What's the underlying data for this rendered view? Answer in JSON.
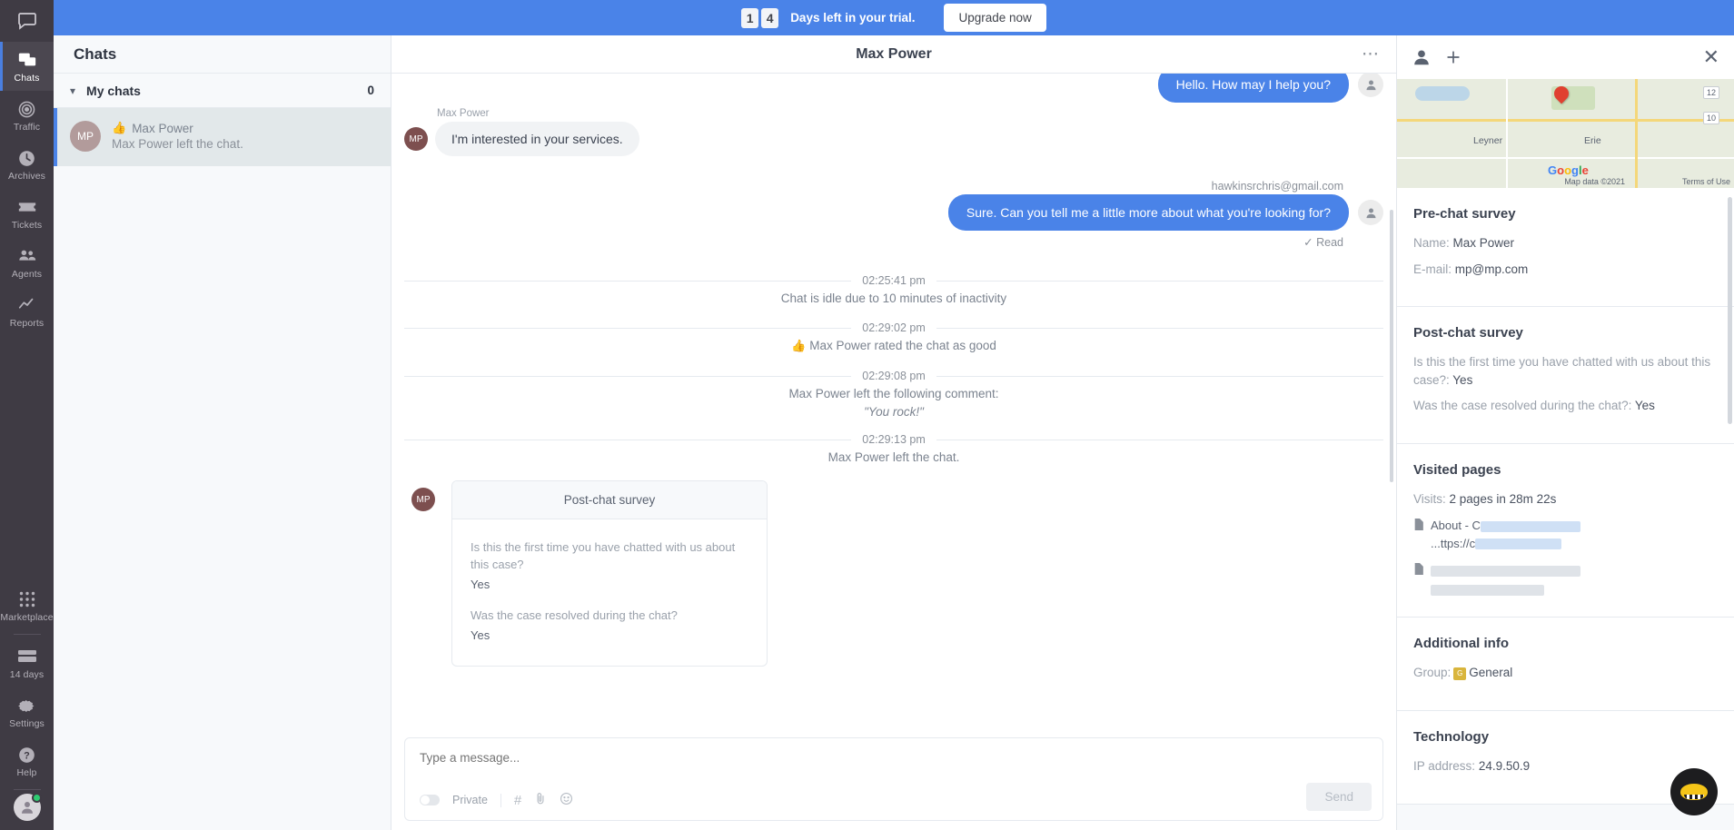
{
  "banner": {
    "digits": [
      "1",
      "4"
    ],
    "text": "Days left in your trial.",
    "upgrade_label": "Upgrade now"
  },
  "rail": {
    "logo_icon": "chat-bubble-logo-icon",
    "items": [
      {
        "label": "Chats",
        "icon": "chats-icon",
        "active": true
      },
      {
        "label": "Traffic",
        "icon": "traffic-icon",
        "active": false
      },
      {
        "label": "Archives",
        "icon": "clock-icon",
        "active": false
      },
      {
        "label": "Tickets",
        "icon": "ticket-icon",
        "active": false
      },
      {
        "label": "Agents",
        "icon": "agents-icon",
        "active": false
      },
      {
        "label": "Reports",
        "icon": "reports-icon",
        "active": false
      }
    ],
    "bottom_items": [
      {
        "label": "Marketplace",
        "icon": "grid-icon"
      },
      {
        "label": "14 days",
        "icon": "card-icon"
      },
      {
        "label": "Settings",
        "icon": "gear-icon"
      },
      {
        "label": "Help",
        "icon": "question-icon"
      }
    ]
  },
  "chatlist": {
    "header": "Chats",
    "group_label": "My chats",
    "group_count": "0",
    "items": [
      {
        "initials": "MP",
        "name": "Max Power",
        "snippet": "Max Power left the chat.",
        "rating_icon": "thumbs-up-icon"
      }
    ]
  },
  "conversation": {
    "title": "Max Power",
    "more_icon": "more-options-icon",
    "messages": {
      "greeting_out": "Hello. How may I help you?",
      "sender_label": "Max Power",
      "incoming_1": "I'm interested in your services.",
      "agent_email": "hawkinsrchris@gmail.com",
      "outgoing_1": "Sure. Can you tell me a little more about what you're looking for?",
      "read_status": "✓ Read"
    },
    "system_events": [
      {
        "time": "02:25:41 pm",
        "text": "Chat is idle due to 10 minutes of inactivity",
        "icon": ""
      },
      {
        "time": "02:29:02 pm",
        "text": "Max Power rated the chat as good",
        "icon": "thumbs-up-icon"
      },
      {
        "time": "02:29:08 pm",
        "text": "Max Power left the following comment:",
        "quote": "\"You rock!\""
      },
      {
        "time": "02:29:13 pm",
        "text": "Max Power left the chat.",
        "icon": ""
      }
    ],
    "survey_card": {
      "initials": "MP",
      "title": "Post-chat survey",
      "questions": [
        {
          "q": "Is this the first time you have chatted with us about this case?",
          "a": "Yes"
        },
        {
          "q": "Was the case resolved during the chat?",
          "a": "Yes"
        }
      ]
    },
    "composer": {
      "placeholder": "Type a message...",
      "private_label": "Private",
      "hash_icon": "hash-icon",
      "attach_icon": "paperclip-icon",
      "emoji_icon": "emoji-icon",
      "send_label": "Send"
    }
  },
  "right_panel": {
    "profile_icon": "person-icon",
    "add_icon": "plus-icon",
    "close_icon": "close-icon",
    "map": {
      "labels": [
        "Leyner",
        "Erie"
      ],
      "badges": [
        "12",
        "10"
      ],
      "google_letters": [
        "G",
        "o",
        "o",
        "g",
        "l",
        "e"
      ],
      "credit": "Map data ©2021",
      "terms": "Terms of Use",
      "pin_icon": "map-pin-icon"
    },
    "cards": [
      {
        "title": "Pre-chat survey",
        "rows": [
          {
            "key": "Name:",
            "value": "Max Power"
          },
          {
            "key": "E-mail:",
            "value": "mp@mp.com"
          }
        ]
      },
      {
        "title": "Post-chat survey",
        "rows": [
          {
            "key": "Is this the first time you have chatted with us about this case?:",
            "value": "Yes"
          },
          {
            "key": "Was the case resolved during the chat?:",
            "value": "Yes"
          }
        ]
      },
      {
        "title": "Visited pages",
        "rows": [
          {
            "key": "Visits:",
            "value": "2 pages in 28m 22s"
          }
        ],
        "visits": [
          {
            "title": "About - C",
            "url": "...ttps://c"
          },
          {
            "title": "",
            "url": ""
          }
        ]
      },
      {
        "title": "Additional info",
        "rows": [
          {
            "key": "Group:",
            "value": "General",
            "badge": "G"
          }
        ]
      },
      {
        "title": "Technology",
        "rows": [
          {
            "key": "IP address:",
            "value": "24.9.50.9"
          }
        ]
      }
    ]
  },
  "fab": {
    "icon": "bee-widget-icon"
  },
  "colors": {
    "accent_blue": "#4a83e8",
    "rail_bg": "#3f3b44",
    "panel_bg": "#f7f9fb",
    "green": "#3dc47e"
  }
}
